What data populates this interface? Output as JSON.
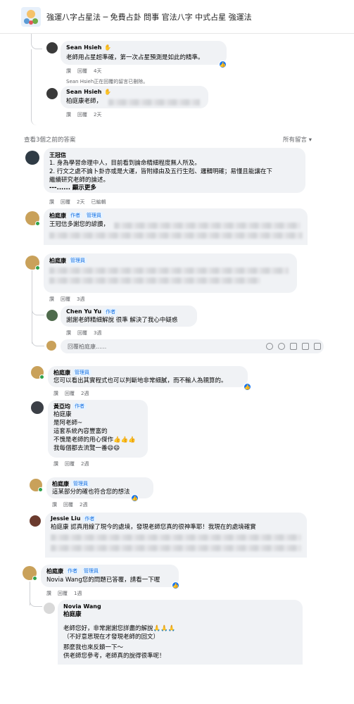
{
  "header": {
    "title": "強運八字占星法 ─ 免費占卦 問事 官法八字 中式占星 強運法"
  },
  "actions": {
    "like": "讚",
    "reply": "回覆",
    "edited": "已編輯"
  },
  "section1": {
    "c1": {
      "name": "Sean Hsieh",
      "text": "老師用占星超準確，第一次占星預測是如此的精準。",
      "time": "4天"
    },
    "deleted_note": "Sean Hsieh正在回覆的留言已刪除。",
    "c2": {
      "name": "Sean Hsieh",
      "text": "柏庭康老師，",
      "time": "2天"
    }
  },
  "section2": {
    "prev_link": "查看3個之前的答案",
    "sort_label": "所有留言",
    "c1": {
      "name": "王冠信",
      "lines": [
        "1. 身為學習命理中人，目前看到論命精細程度無人所及。",
        "2. 行文之處不論卜卦亦或是大運，皆附緣由及五行生剋、邏輯明確；易懂且能讓在下",
        "繼續研究老師的論述。",
        "---...... 顯示更多"
      ],
      "time": "2天"
    },
    "c2": {
      "name": "柏庭康",
      "badges": [
        "作者",
        "管理員"
      ],
      "text": "王冠信多謝您的諺讚，"
    }
  },
  "section3": {
    "c1": {
      "name": "柏庭康",
      "badge": "管理員",
      "time": "3週"
    },
    "c2": {
      "name": "Chen Yu Yu",
      "badge": "作者",
      "text": "謝謝老師精細解說 很準 解決了我心中疑惑",
      "time": "3週"
    },
    "reply_placeholder": "回覆柏庭康......"
  },
  "section4": {
    "c1": {
      "name": "柏庭康",
      "badge": "管理員",
      "text": "您可以看出其實程式也可以判斷地非常細膩，而不輸人為親算的。",
      "time": "2週"
    },
    "c2": {
      "name": "黃亞均",
      "badge": "作者",
      "lines": [
        "柏庭康",
        "是阿老師~",
        "這套系統內容豐富的",
        "不愧是老師的用心傑作👍👍👍",
        "我每個都去流覽一番😄😄"
      ],
      "time": "2週"
    }
  },
  "section5": {
    "c1": {
      "name": "柏庭康",
      "badge": "管理員",
      "text": "這某部分的確也符合您的想法",
      "time": "2週"
    },
    "c2": {
      "name": "Jessie Liu",
      "badge": "作者",
      "text": "柏庭康 認真用線了現今的處境，發現老師您真的很神準耶！我現在的處境確實"
    }
  },
  "section6": {
    "c1": {
      "name": "柏庭康",
      "badges": [
        "作者",
        "管理員"
      ],
      "text": "Novia Wang您的問題已答覆，請看一下喔",
      "time": "1週"
    },
    "c2": {
      "name": "Novia Wang",
      "lines": [
        "柏庭康",
        "老師您好，非常謝謝您詳盡的解說🙏🙏🙏",
        "（不好意思現在才發現老師的回文）",
        "那麼我也來反饋一下～",
        "供老師您參考，老師真的說得很準呢！"
      ]
    }
  }
}
